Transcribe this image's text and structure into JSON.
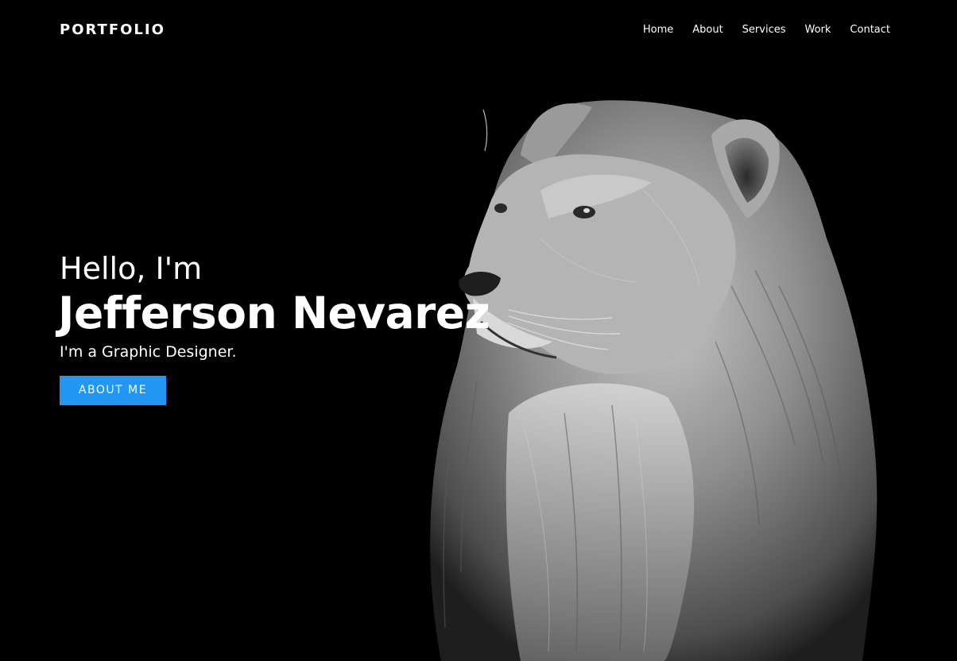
{
  "brand": {
    "logo_text": "PORTFOLIO"
  },
  "nav": {
    "items": [
      {
        "label": "Home"
      },
      {
        "label": "About"
      },
      {
        "label": "Services"
      },
      {
        "label": "Work"
      },
      {
        "label": "Contact"
      }
    ]
  },
  "hero": {
    "greeting": "Hello, I'm",
    "name": "Jefferson Nevarez",
    "role": "I'm a Graphic Designer.",
    "cta_label": "ABOUT ME",
    "image_subject": "lioness"
  },
  "colors": {
    "background": "#000000",
    "text": "#ffffff",
    "accent": "#2196f3"
  }
}
